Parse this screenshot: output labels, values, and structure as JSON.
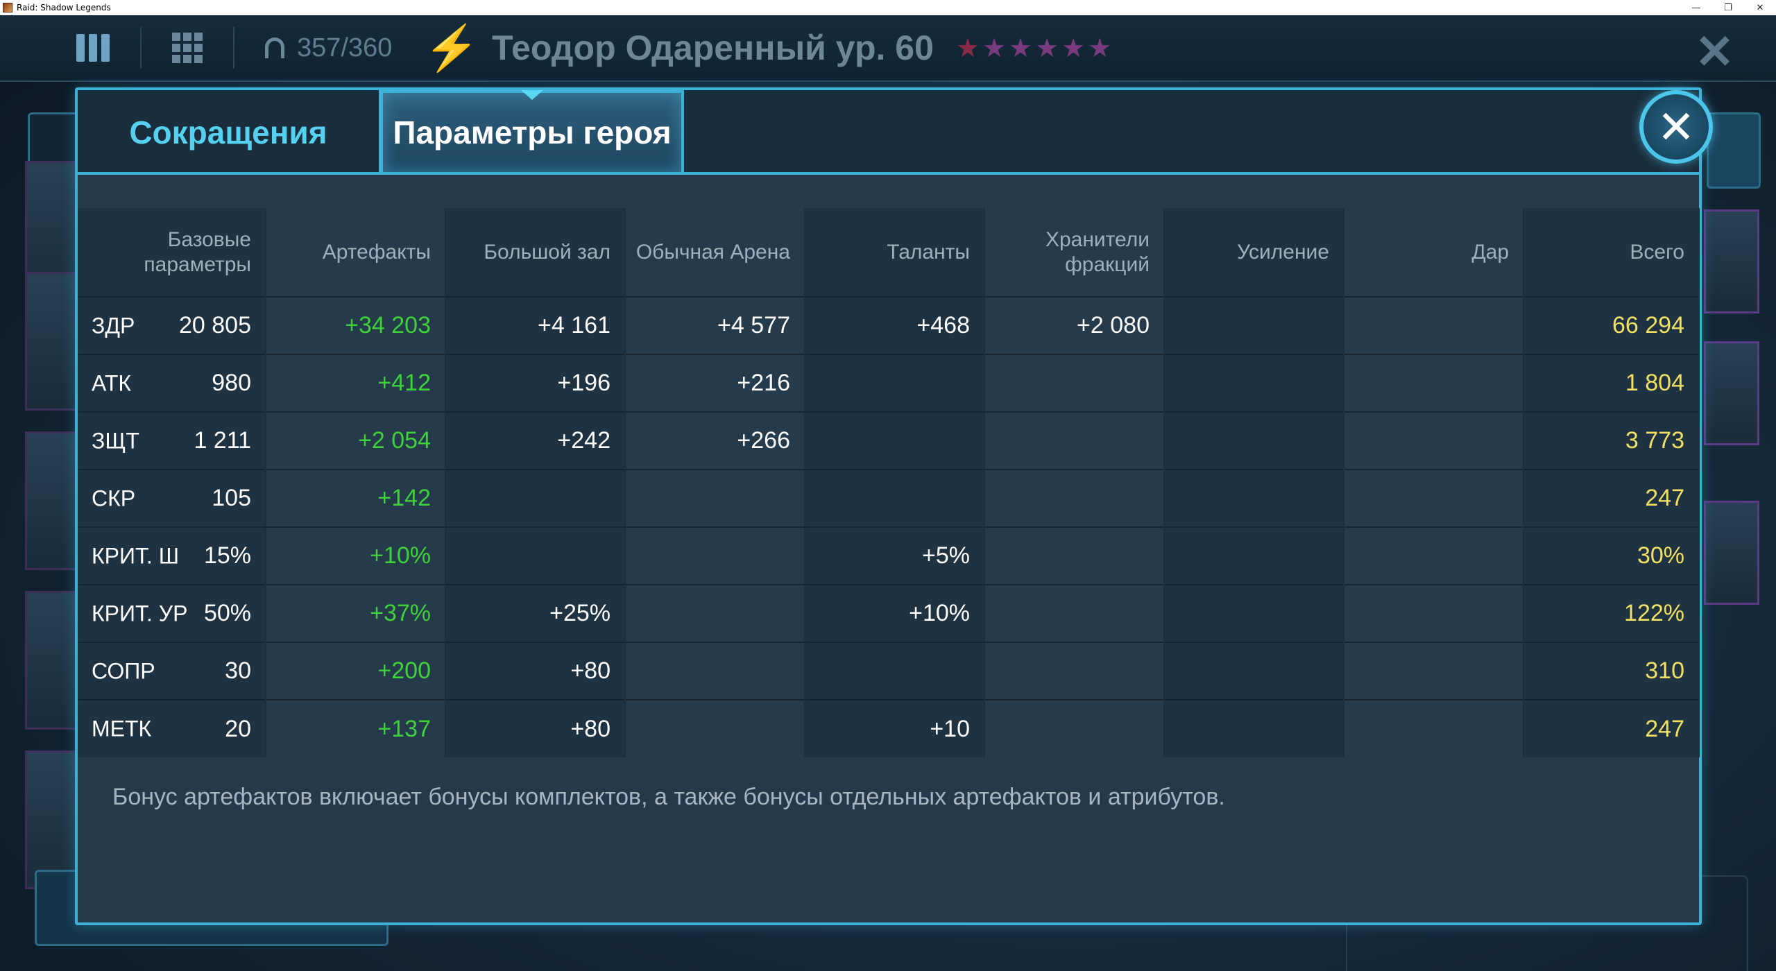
{
  "window": {
    "title": "Raid: Shadow Legends",
    "controls": [
      "—",
      "❐",
      "✕"
    ]
  },
  "topbar": {
    "energy": "357/360",
    "hero_title": "Теодор Одаренный ур. 60",
    "stars_count": 6,
    "stars": "★★★★★★"
  },
  "modal": {
    "tabs": [
      {
        "label": "Сокращения",
        "active": false
      },
      {
        "label": "Параметры героя",
        "active": true
      }
    ],
    "close_symbol": "✕",
    "table": {
      "headers": [
        "Базовые параметры",
        "Артефакты",
        "Большой зал",
        "Обычная Арена",
        "Таланты",
        "Хранители фракций",
        "Усиление",
        "Дар",
        "Всего"
      ],
      "rows": [
        {
          "stat": "ЗДР",
          "base": "20 805",
          "artifacts": "+34 203",
          "great_hall": "+4 161",
          "arena": "+4 577",
          "talents": "+468",
          "faction_guardians": "+2 080",
          "empower": "",
          "gift": "",
          "total": "66 294"
        },
        {
          "stat": "АТК",
          "base": "980",
          "artifacts": "+412",
          "great_hall": "+196",
          "arena": "+216",
          "talents": "",
          "faction_guardians": "",
          "empower": "",
          "gift": "",
          "total": "1 804"
        },
        {
          "stat": "ЗЩТ",
          "base": "1 211",
          "artifacts": "+2 054",
          "great_hall": "+242",
          "arena": "+266",
          "talents": "",
          "faction_guardians": "",
          "empower": "",
          "gift": "",
          "total": "3 773"
        },
        {
          "stat": "СКР",
          "base": "105",
          "artifacts": "+142",
          "great_hall": "",
          "arena": "",
          "talents": "",
          "faction_guardians": "",
          "empower": "",
          "gift": "",
          "total": "247"
        },
        {
          "stat": "КРИТ. Ш",
          "base": "15%",
          "artifacts": "+10%",
          "great_hall": "",
          "arena": "",
          "talents": "+5%",
          "faction_guardians": "",
          "empower": "",
          "gift": "",
          "total": "30%"
        },
        {
          "stat": "КРИТ. УР",
          "base": "50%",
          "artifacts": "+37%",
          "great_hall": "+25%",
          "arena": "",
          "talents": "+10%",
          "faction_guardians": "",
          "empower": "",
          "gift": "",
          "total": "122%"
        },
        {
          "stat": "СОПР",
          "base": "30",
          "artifacts": "+200",
          "great_hall": "+80",
          "arena": "",
          "talents": "",
          "faction_guardians": "",
          "empower": "",
          "gift": "",
          "total": "310"
        },
        {
          "stat": "МЕТК",
          "base": "20",
          "artifacts": "+137",
          "great_hall": "+80",
          "arena": "",
          "talents": "+10",
          "faction_guardians": "",
          "empower": "",
          "gift": "",
          "total": "247"
        }
      ]
    },
    "footnote": "Бонус артефактов включает бонусы комплектов, а также бонусы отдельных артефактов и атрибутов."
  },
  "colors": {
    "accent": "#3bb2d6",
    "artifact_green": "#3fd13a",
    "total_yellow": "#f1e064",
    "tab_inactive_text": "#55d1ef"
  },
  "icons": [
    "menu-bars-icon",
    "grid-icon",
    "headset-icon",
    "energy-bolt-icon",
    "star-icon",
    "close-icon"
  ]
}
